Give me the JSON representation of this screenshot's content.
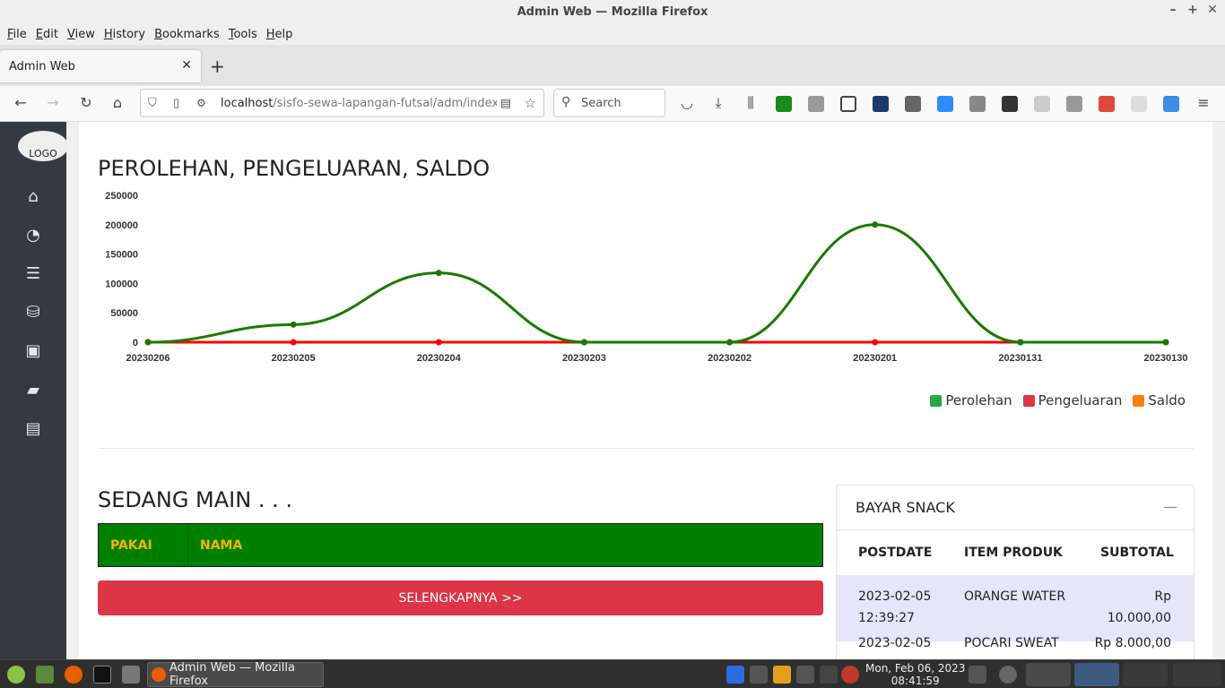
{
  "window": {
    "title": "Admin Web — Mozilla Firefox"
  },
  "menu": [
    "File",
    "Edit",
    "View",
    "History",
    "Bookmarks",
    "Tools",
    "Help"
  ],
  "tab": {
    "label": "Admin Web"
  },
  "url": {
    "host": "localhost",
    "path": "/sisfo-sewa-lapangan-futsal/adm/index.p"
  },
  "search": {
    "placeholder": "Search"
  },
  "sidebar": {
    "logo": "LOGO",
    "icons": [
      "home-icon",
      "dashboard-icon",
      "server-icon",
      "database-icon",
      "money-icon",
      "book-icon",
      "archive-icon"
    ]
  },
  "chart": {
    "title": "PEROLEHAN, PENGELUARAN, SALDO"
  },
  "chart_data": {
    "type": "line",
    "title": "PEROLEHAN, PENGELUARAN, SALDO",
    "x": [
      "20230206",
      "20230205",
      "20230204",
      "20230203",
      "20230202",
      "20230201",
      "20230131",
      "20230130"
    ],
    "series": [
      {
        "name": "Perolehan",
        "color": "#1a7a00",
        "values": [
          0,
          30000,
          118000,
          0,
          0,
          200000,
          0,
          0
        ]
      },
      {
        "name": "Pengeluaran",
        "color": "#ff0000",
        "values": [
          0,
          0,
          0,
          0,
          0,
          0,
          0,
          0
        ]
      },
      {
        "name": "Saldo",
        "color": "#f57d1f",
        "values": [
          0,
          0,
          0,
          0,
          0,
          0,
          0,
          0
        ]
      }
    ],
    "yticks": [
      "250000",
      "200000",
      "150000",
      "100000",
      "50000",
      "0"
    ],
    "ylim": [
      0,
      250000
    ],
    "legend": [
      {
        "name": "Perolehan",
        "color": "#28a745"
      },
      {
        "name": "Pengeluaran",
        "color": "#dc3545"
      },
      {
        "name": "Saldo",
        "color": "#fd7e14"
      }
    ],
    "legend_position": "bottom-right"
  },
  "sedang_main": {
    "title": "SEDANG MAIN . . .",
    "col_pakai": "PAKAI",
    "col_nama": "NAMA",
    "button": "SELENGKAPNYA >>"
  },
  "bayar_snack": {
    "title": "BAYAR SNACK",
    "minimize": "—",
    "headers": [
      "POSTDATE",
      "ITEM PRODUK",
      "SUBTOTAL"
    ],
    "rows": [
      {
        "date": "2023-02-05",
        "time": "12:39:27",
        "item": "ORANGE WATER",
        "cur": "Rp",
        "amount": "10.000,00"
      },
      {
        "date": "2023-02-05",
        "item": "POCARI SWEAT",
        "amount": "Rp 8.000,00"
      }
    ]
  },
  "taskbar": {
    "window_label": "Admin Web — Mozilla Firefox",
    "date": "Mon, Feb 06, 2023",
    "time": "08:41:59"
  }
}
